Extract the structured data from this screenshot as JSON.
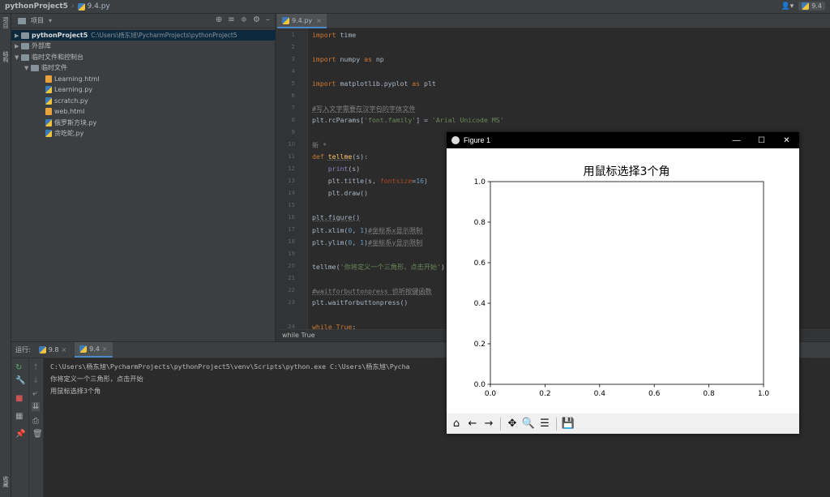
{
  "navbar": {
    "project_name": "pythonProject5",
    "file_name": "9.4.py",
    "run_config": "9.4"
  },
  "leftstrip": {
    "project_label": "项目",
    "structure_label": "结构",
    "favorites_label": "收藏"
  },
  "project_panel": {
    "title": "项目",
    "root_name": "pythonProject5",
    "root_path": "C:\\Users\\杨东旭\\PycharmProjects\\pythonProject5",
    "external_libs": "外部库",
    "scratches": "临时文件和控制台",
    "scratch_folder": "临时文件",
    "files": [
      "Learning.html",
      "Learning.py",
      "scratch.py",
      "web.html",
      "俄罗斯方块.py",
      "贪吃蛇.py"
    ]
  },
  "editor": {
    "tab_label": "9.4.py",
    "line_numbers": [
      "1",
      "2",
      "3",
      "4",
      "5",
      "6",
      "7",
      "8",
      "9",
      "10",
      "11",
      "12",
      "13",
      "14",
      "15",
      "16",
      "17",
      "18",
      "19",
      "20",
      "21",
      "22",
      "23",
      "24"
    ],
    "status_text": "while True"
  },
  "run_panel": {
    "label": "运行:",
    "tabs": [
      "9.8",
      "9.4"
    ],
    "console_lines": [
      "C:\\Users\\杨东旭\\PycharmProjects\\pythonProject5\\venv\\Scripts\\python.exe C:\\Users\\杨东旭\\Pycha",
      "你将定义一个三角形，点击开始",
      "用鼠标选择3个角"
    ]
  },
  "figure": {
    "window_title": "Figure 1",
    "toolbar_icons": [
      "home-icon",
      "back-icon",
      "forward-icon",
      "pan-icon",
      "zoom-icon",
      "configure-icon",
      "save-icon"
    ]
  },
  "chart_data": {
    "type": "scatter",
    "title": "用鼠标选择3个角",
    "xlabel": "",
    "ylabel": "",
    "xlim": [
      0.0,
      1.0
    ],
    "ylim": [
      0.0,
      1.0
    ],
    "xticks": [
      "0.0",
      "0.2",
      "0.4",
      "0.6",
      "0.8",
      "1.0"
    ],
    "yticks": [
      "0.0",
      "0.2",
      "0.4",
      "0.6",
      "0.8",
      "1.0"
    ],
    "series": [],
    "grid": false
  }
}
